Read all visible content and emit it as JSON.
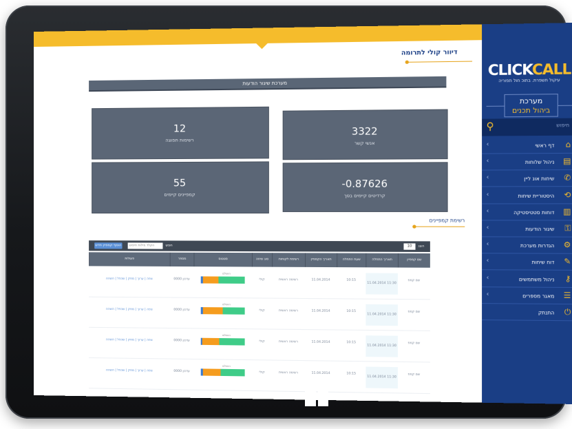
{
  "sidebar": {
    "logo_click": "CLICK",
    "logo_call": "CALL",
    "logo_sub": "עיקול תשפרת. בתוכ חול תפוריה",
    "brand_line1": "מערכת",
    "brand_line2": "ביהול תכנים",
    "search_placeholder": "חיפוש",
    "items": [
      {
        "label": "דף ראשי",
        "icon": "⌂"
      },
      {
        "label": "ניהול שלוחות",
        "icon": "▤"
      },
      {
        "label": "שיחות אונ ליין",
        "icon": "✆"
      },
      {
        "label": "היסטוריית שיחות",
        "icon": "⟲"
      },
      {
        "label": "דוחות סטטיסטיקה",
        "icon": "▥"
      },
      {
        "label": "שיגור הודעות",
        "icon": "⚿"
      },
      {
        "label": "הגדרות מערכת",
        "icon": "⚙"
      },
      {
        "label": "דוח שיחות",
        "icon": "✎"
      },
      {
        "label": "ניהול משתמשים",
        "icon": "⚷"
      },
      {
        "label": "מאגר מספרים",
        "icon": "☰"
      },
      {
        "label": "התנתק",
        "icon": "⏻"
      }
    ]
  },
  "page": {
    "title": "דיוור קולי לתרומה"
  },
  "stats": {
    "header": "מערכת שיגור הודעות",
    "cards": [
      {
        "value": "3322",
        "label": "אנשי קשר"
      },
      {
        "value": "12",
        "label": "רשימות תפוצה"
      },
      {
        "value": "-0.87626",
        "label": "קרדיטים קיימים בסך"
      },
      {
        "value": "55",
        "label": "קמפיינים קיימים"
      }
    ]
  },
  "customers": {
    "title": "רשימת קמפיינים",
    "show_label": "הצג",
    "show_value": "10",
    "search_label": "חפש",
    "search_placeholder": "הקלד מילות חיפוש",
    "add_button": "הוסף קמפיין חדש",
    "columns": [
      "שם קמפיין",
      "תאריך התחלה",
      "שעת התחלה",
      "תאריך הקמפיין",
      "רשימת לקוחות",
      "סוג שיחה",
      "סטטוס",
      "מספר",
      "פעולות"
    ],
    "rows": [
      {
        "name": "שם קמפ",
        "date": "11.04.2014 11:30",
        "time": "10:15",
        "created": "11.04.2014",
        "list": "רשימה ראשית",
        "type": "קולי",
        "status_caption": "הושלם",
        "progress": [
          0.05,
          0.35,
          0.6
        ],
        "number": "0000 עדכון",
        "actions": "צפה | ערוך | מחק | שכפל | השהה"
      },
      {
        "name": "שם קמפ",
        "date": "11.04.2014 11:30",
        "time": "10:15",
        "created": "11.04.2014",
        "list": "רשימה ראשית",
        "type": "קולי",
        "status_caption": "הושלם",
        "progress": [
          0.05,
          0.45,
          0.5
        ],
        "number": "0000 עדכון",
        "actions": "צפה | ערוך | מחק | שכפל | השהה"
      },
      {
        "name": "שם קמפ",
        "date": "11.04.2014 11:30",
        "time": "10:15",
        "created": "11.04.2014",
        "list": "רשימה ראשית",
        "type": "קולי",
        "status_caption": "הושלם",
        "progress": [
          0.04,
          0.38,
          0.58
        ],
        "number": "0000 עדכון",
        "actions": "צפה | ערוך | מחק | שכפל | השהה"
      },
      {
        "name": "שם קמפ",
        "date": "11.04.2014 11:30",
        "time": "10:15",
        "created": "11.04.2014",
        "list": "רשימה ראשית",
        "type": "קולי",
        "status_caption": "הושלם",
        "progress": [
          0.05,
          0.4,
          0.55
        ],
        "number": "0000 עדכון",
        "actions": "צפה | ערוך | מחק | שכפל | השהה"
      }
    ]
  },
  "colors": {
    "sidebar": "#1a3e85",
    "accent": "#f5bc2c",
    "card": "#5b6676"
  }
}
